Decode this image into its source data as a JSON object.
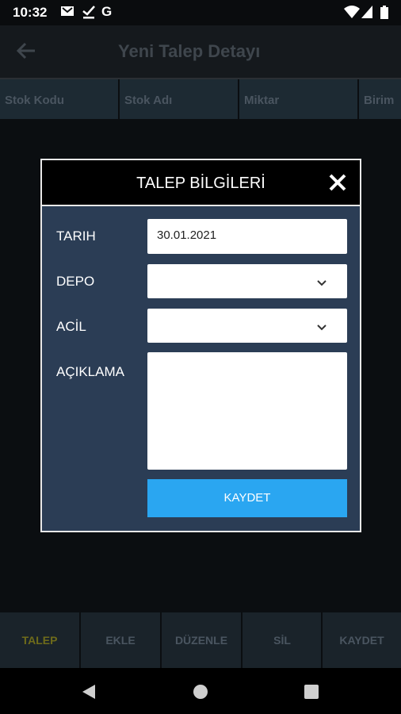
{
  "status_bar": {
    "time": "10:32",
    "icons": [
      "gmail-icon",
      "download-done-icon",
      "google-icon",
      "wifi-icon",
      "signal-icon",
      "battery-icon"
    ]
  },
  "app_bar": {
    "title": "Yeni Talep Detayı"
  },
  "columns": [
    "Stok Kodu",
    "Stok Adı",
    "Miktar",
    "Birim"
  ],
  "dialog": {
    "title": "TALEP BİLGİLERİ",
    "fields": {
      "tarih_label": "TARIH",
      "tarih_value": "30.01.2021",
      "depo_label": "DEPO",
      "depo_value": "",
      "acil_label": "ACİL",
      "acil_value": "",
      "aciklama_label": "AÇIKLAMA",
      "aciklama_value": ""
    },
    "save_label": "KAYDET",
    "colors": {
      "background": "#2b3d55",
      "header": "#000000",
      "save_button": "#2aa6f1"
    }
  },
  "toolbar": {
    "items": [
      "TALEP",
      "EKLE",
      "DÜZENLE",
      "SİL",
      "KAYDET"
    ],
    "active": "TALEP"
  }
}
